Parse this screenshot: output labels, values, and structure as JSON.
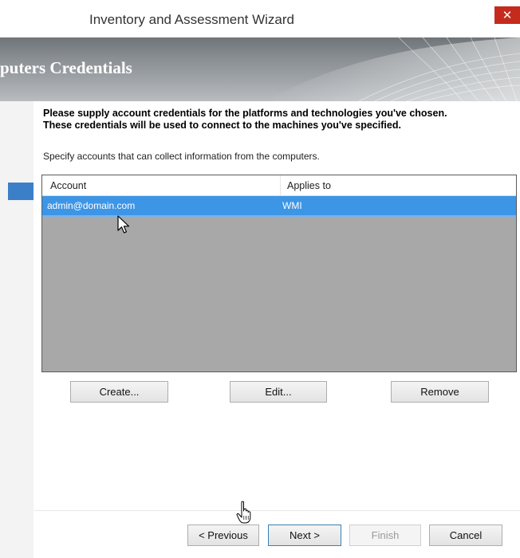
{
  "window": {
    "title": "Inventory and Assessment Wizard",
    "close_glyph": "✕"
  },
  "banner": {
    "title": "puters Credentials"
  },
  "instructions": {
    "line1": "Please supply account credentials for the platforms and technologies you've chosen.",
    "line2": "These credentials will be used to connect to the machines you've specified.",
    "specify": "Specify accounts that can collect information from the computers."
  },
  "accounts_table": {
    "columns": [
      "Account",
      "Applies to"
    ],
    "rows": [
      {
        "account": "admin@domain.com",
        "applies_to": "WMI",
        "selected": true
      }
    ]
  },
  "list_actions": {
    "create": "Create...",
    "edit": "Edit...",
    "remove": "Remove"
  },
  "navigation": {
    "previous": "< Previous",
    "next": "Next >",
    "finish": "Finish",
    "cancel": "Cancel"
  },
  "colors": {
    "selection": "#3d95e6",
    "list_background": "#a8a8a8",
    "close_button": "#c42b1c",
    "left_nav_active": "#3a7fc8"
  },
  "icons": {
    "close": "close-icon",
    "pointer_cursor": "arrow-cursor-icon",
    "hand_cursor": "hand-cursor-icon"
  }
}
